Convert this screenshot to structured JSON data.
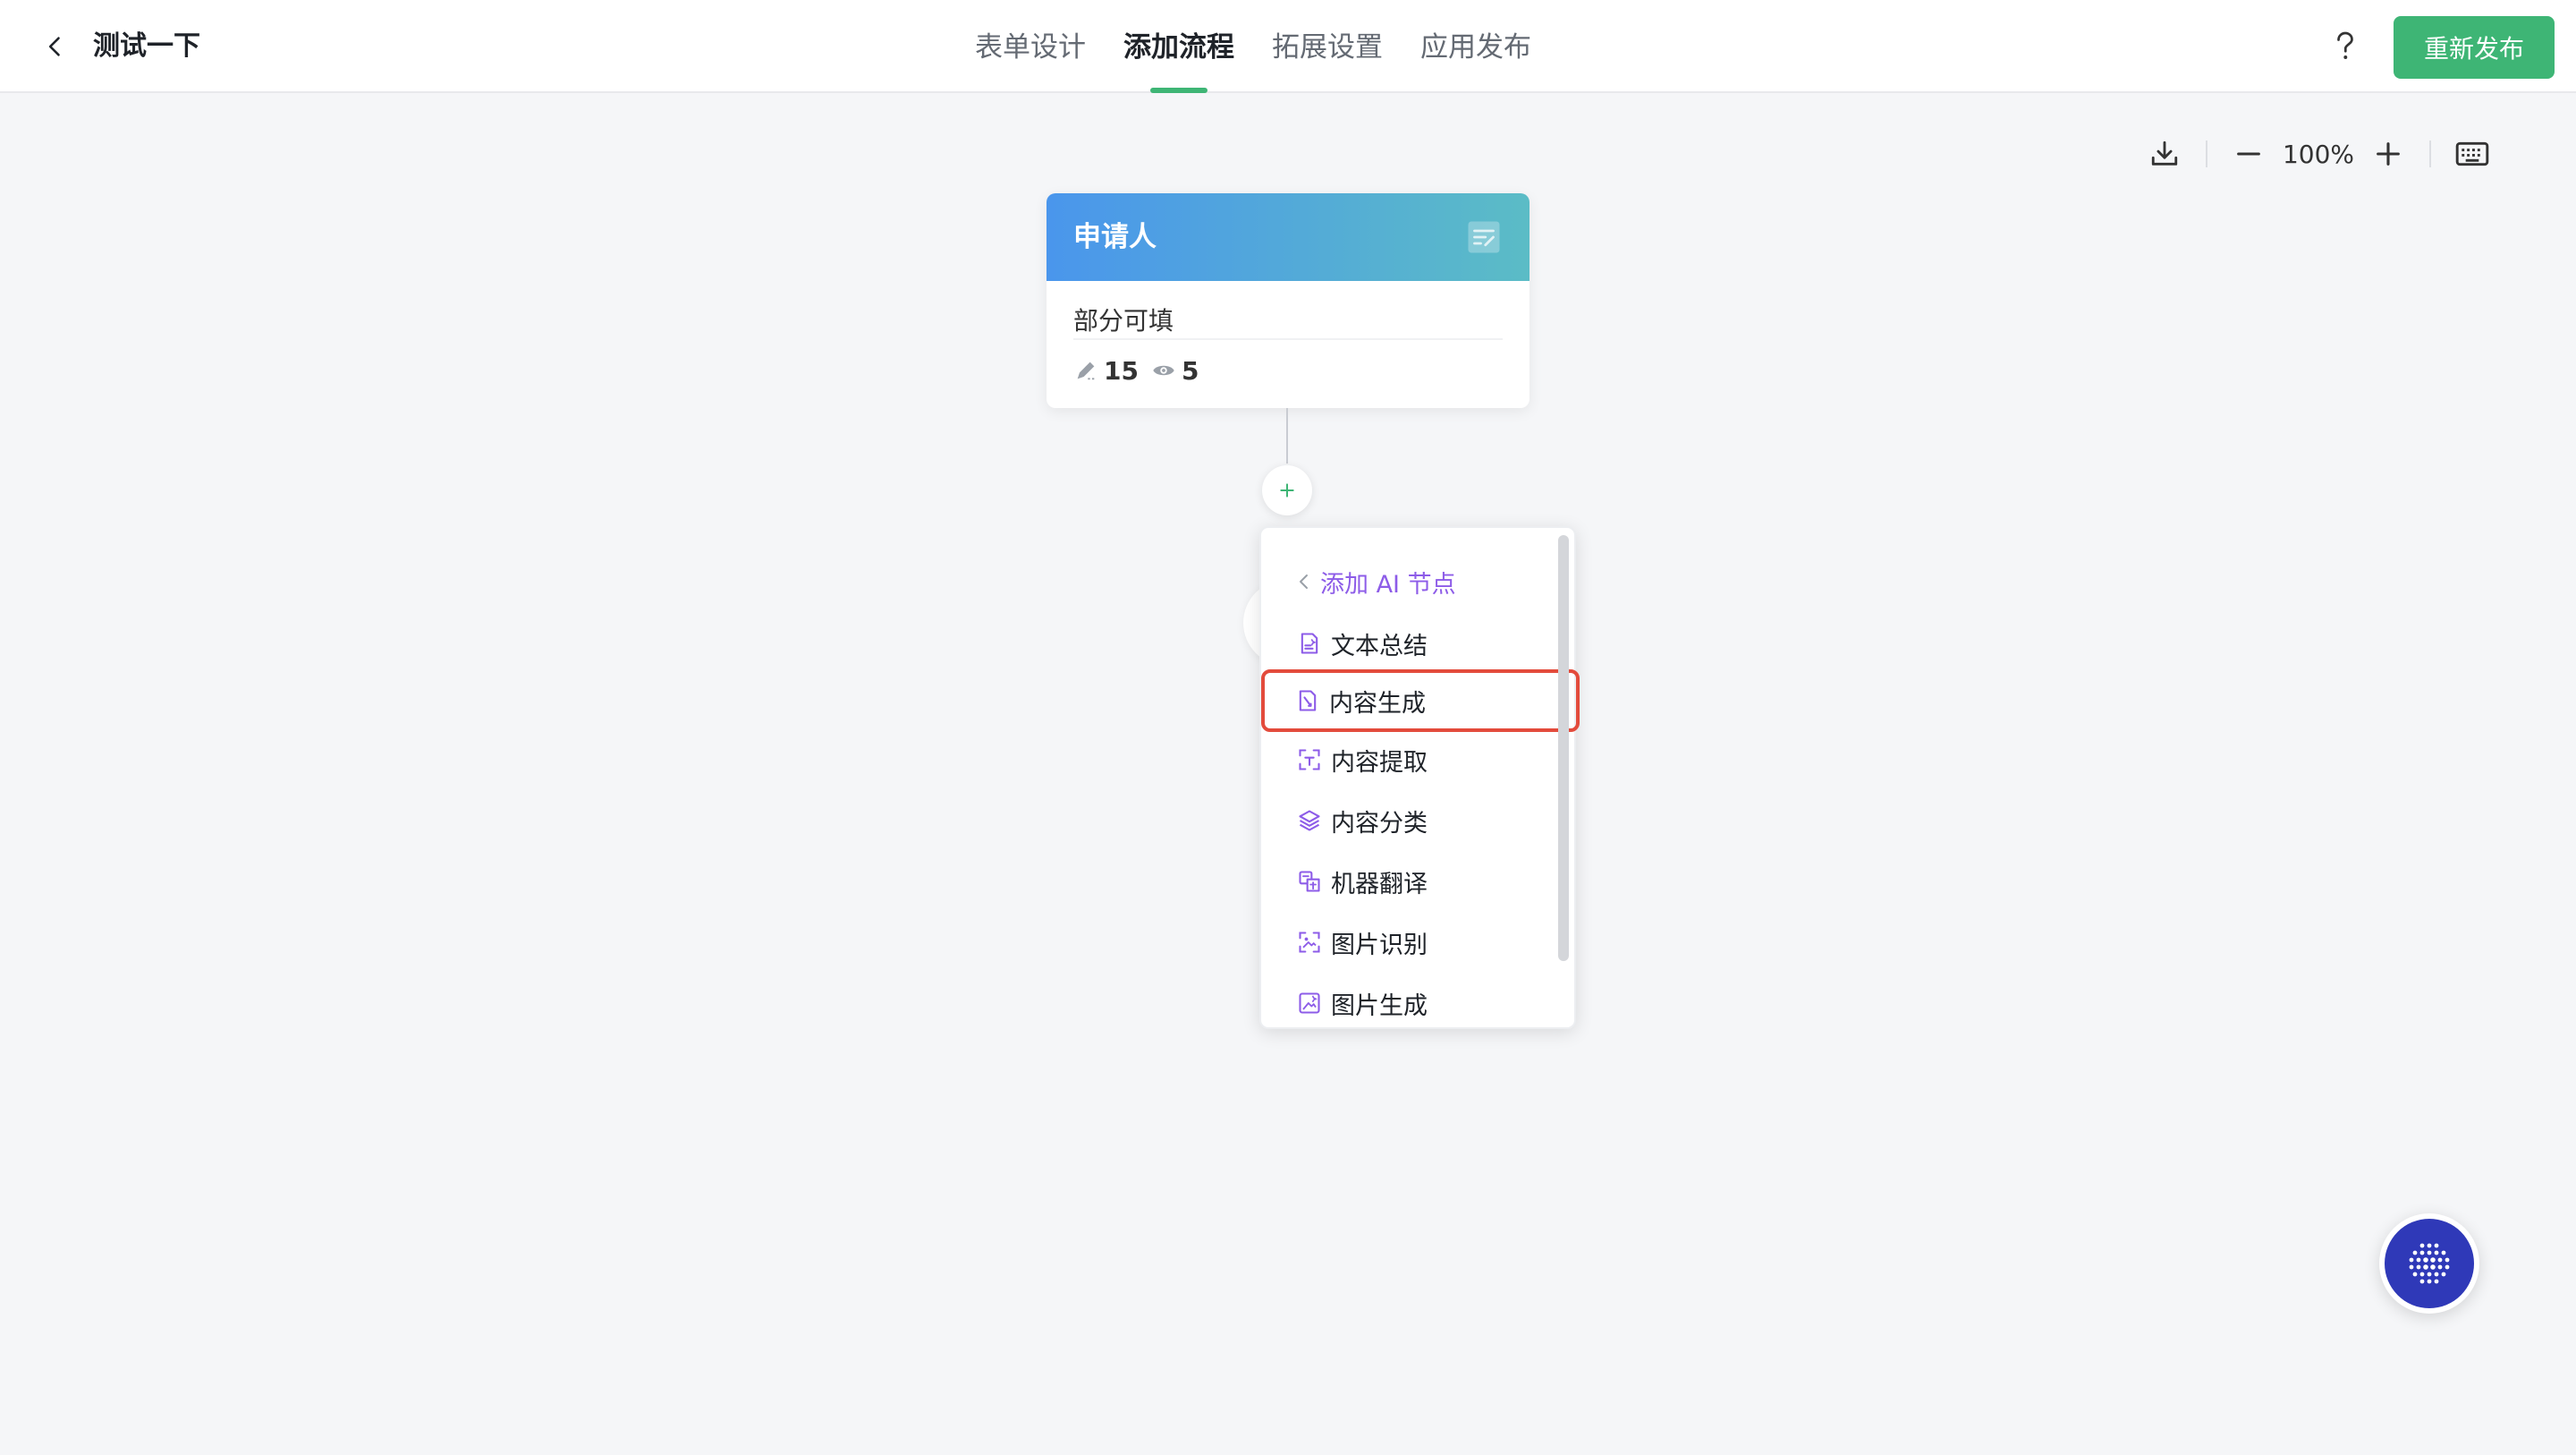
{
  "header": {
    "title": "测试一下",
    "tabs": [
      {
        "label": "表单设计"
      },
      {
        "label": "添加流程"
      },
      {
        "label": "拓展设置"
      },
      {
        "label": "应用发布"
      }
    ],
    "active_tab": "添加流程",
    "help_label": "?",
    "republish_label": "重新发布"
  },
  "toolbar": {
    "zoom": "100%"
  },
  "node": {
    "title": "申请人",
    "permission": "部分可填",
    "edit_count": "15",
    "view_count": "5"
  },
  "menu": {
    "back_label": "添加 AI 节点",
    "items": [
      {
        "label": "文本总结",
        "icon": "doc-sparkle-icon"
      },
      {
        "label": "内容生成",
        "icon": "doc-edit-icon"
      },
      {
        "label": "内容提取",
        "icon": "extract-icon"
      },
      {
        "label": "内容分类",
        "icon": "layers-icon"
      },
      {
        "label": "机器翻译",
        "icon": "translate-icon"
      },
      {
        "label": "图片识别",
        "icon": "image-scan-icon"
      },
      {
        "label": "图片生成",
        "icon": "image-sparkle-icon"
      }
    ]
  },
  "colors": {
    "accent": "#3eb575",
    "menu_purple": "#8d5ce8",
    "highlight": "#e34b3c",
    "assistant": "#2f39b8"
  }
}
